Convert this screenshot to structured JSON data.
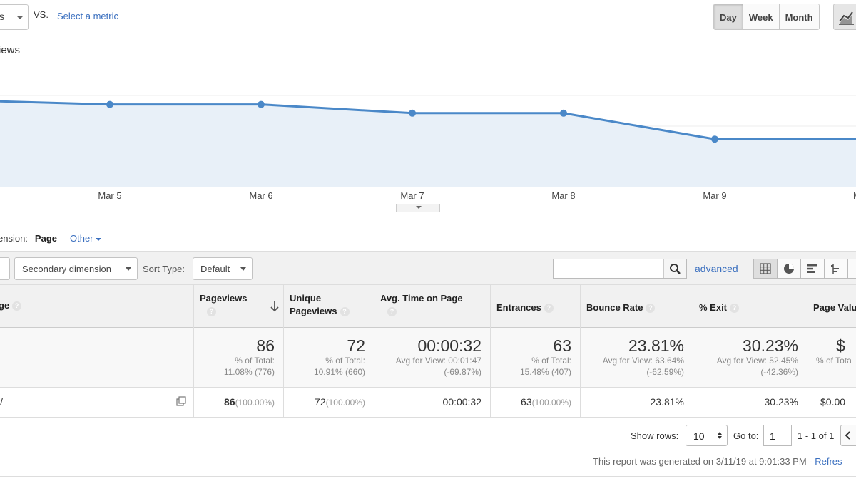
{
  "metric_picker": {
    "selected": "s"
  },
  "vs_label": "VS.",
  "select_metric_link": "Select a metric",
  "period": {
    "day": "Day",
    "week": "Week",
    "month": "Month",
    "active": "Day"
  },
  "chart_title": "iews",
  "chart_data": {
    "type": "area",
    "series": [
      {
        "values": [
          null,
          95,
          95,
          85,
          85,
          55,
          55
        ]
      }
    ],
    "x_labels": [
      "",
      "Mar 5",
      "Mar 6",
      "Mar 7",
      "Mar 8",
      "Mar 9",
      "M"
    ],
    "line_color": "#4a88c8",
    "fill_color": "#e8f0f8",
    "grid": true
  },
  "dimension": {
    "label": "ension:",
    "current": "Page",
    "other": "Other"
  },
  "toolbar": {
    "secondary_dimension": "Secondary dimension",
    "sort_type_label": "Sort Type:",
    "sort_type_value": "Default",
    "search_placeholder": "",
    "advanced": "advanced"
  },
  "table": {
    "headers": {
      "page": "ge",
      "pageviews": "Pageviews",
      "unique_1": "Unique",
      "unique_2": "Pageviews",
      "avg_time": "Avg. Time on Page",
      "entrances": "Entrances",
      "bounce": "Bounce Rate",
      "exit": "% Exit",
      "page_value": "Page Valu"
    },
    "totals": {
      "pageviews": "86",
      "pageviews_sub1": "% of Total:",
      "pageviews_sub2": "11.08% (776)",
      "unique": "72",
      "unique_sub1": "% of Total:",
      "unique_sub2": "10.91% (660)",
      "avg_time": "00:00:32",
      "avg_time_sub1": "Avg for View: 00:01:47",
      "avg_time_sub2": "(-69.87%)",
      "entrances": "63",
      "entrances_sub1": "% of Total:",
      "entrances_sub2": "15.48% (407)",
      "bounce": "23.81%",
      "bounce_sub1": "Avg for View: 63.64%",
      "bounce_sub2": "(-62.59%)",
      "exit": "30.23%",
      "exit_sub1": "Avg for View: 52.45%",
      "exit_sub2": "(-42.36%)",
      "page_value": "$",
      "page_value_sub1": "% of Tota"
    },
    "row": {
      "page": "/",
      "pageviews": "86",
      "pageviews_pct": "(100.00%)",
      "unique": "72",
      "unique_pct": "(100.00%)",
      "avg_time": "00:00:32",
      "entrances": "63",
      "entrances_pct": "(100.00%)",
      "bounce": "23.81%",
      "exit": "30.23%",
      "page_value": "$0.00"
    }
  },
  "pagination": {
    "show_rows_label": "Show rows:",
    "rows_value": "10",
    "goto_label": "Go to:",
    "goto_value": "1",
    "range": "1 - 1 of 1"
  },
  "report_generated": "This report was generated on 3/11/19 at 9:01:33 PM - ",
  "refresh": "Refres"
}
